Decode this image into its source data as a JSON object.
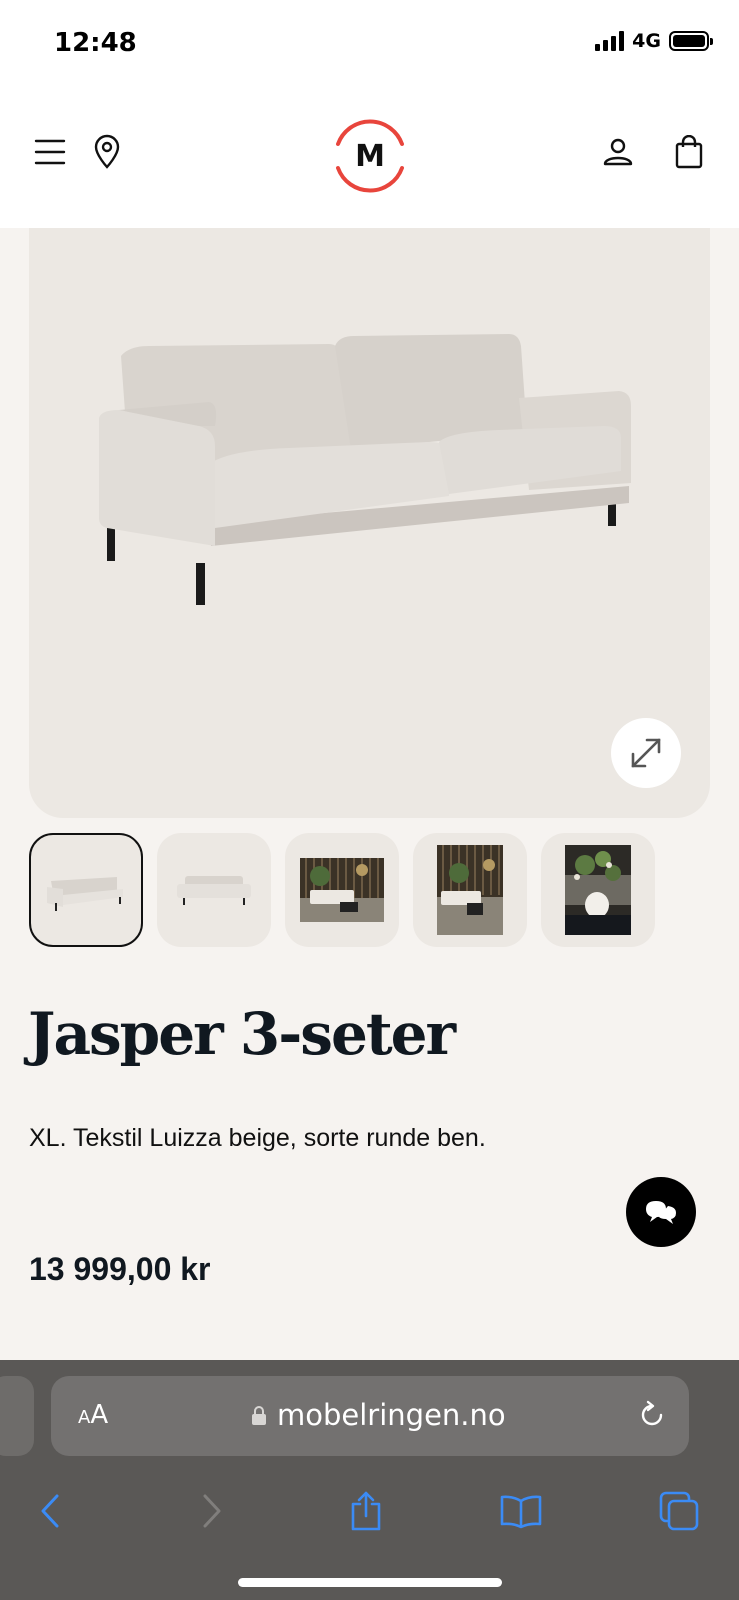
{
  "status_bar": {
    "time": "12:48",
    "network": "4G"
  },
  "header": {
    "logo_letter": "M",
    "brand_color": "#e8453c",
    "icons": [
      "menu-icon",
      "location-pin-icon",
      "user-icon",
      "shopping-bag-icon"
    ]
  },
  "hero": {
    "expand_icon": "expand-arrows-icon"
  },
  "thumbnails": {
    "count": 5,
    "selected_index": 0
  },
  "product": {
    "title": "Jasper 3-seter",
    "description": "XL. Tekstil Luizza beige, sorte runde ben.",
    "price": "13 999,00 kr"
  },
  "chat": {
    "icon": "chat-bubbles-icon"
  },
  "browser": {
    "text_size_small": "A",
    "text_size_large": "A",
    "url": "mobelringen.no",
    "accent_color": "#3b8bf5",
    "toolbar_icons": [
      "back-icon",
      "forward-icon",
      "share-icon",
      "bookmarks-icon",
      "tabs-icon"
    ]
  }
}
